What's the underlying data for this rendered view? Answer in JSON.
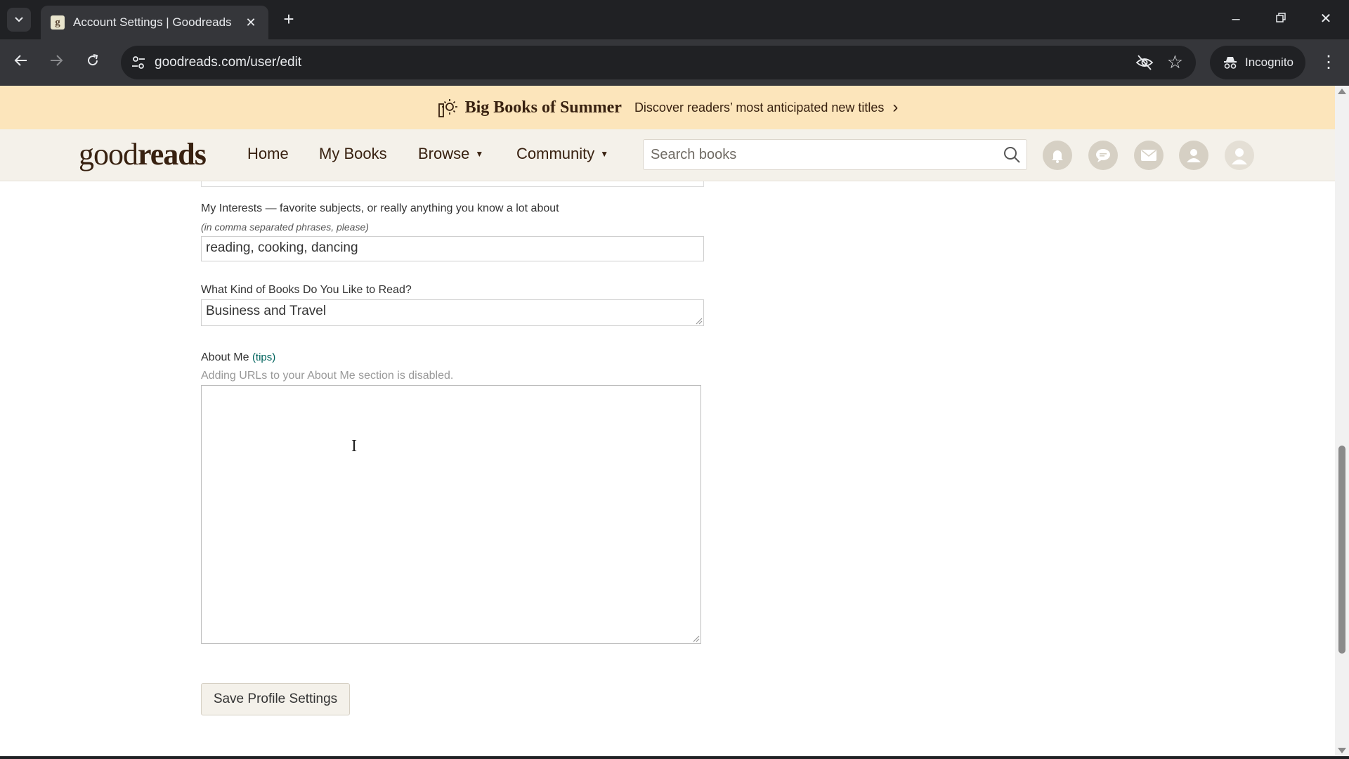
{
  "browser": {
    "tab_title": "Account Settings | Goodreads",
    "tab_favicon": "g",
    "url": "goodreads.com/user/edit",
    "profile_label": "Incognito"
  },
  "banner": {
    "title": "Big Books of Summer",
    "text": "Discover readers’ most anticipated new titles",
    "arrow": "›",
    "icon": "sun-icon"
  },
  "header": {
    "logo_light": "good",
    "logo_bold": "reads",
    "nav": {
      "home": "Home",
      "my_books": "My Books",
      "browse": "Browse",
      "community": "Community"
    },
    "search_placeholder": "Search books",
    "icons": [
      "notifications-icon",
      "discussions-icon",
      "messages-icon",
      "friends-icon",
      "profile-icon"
    ]
  },
  "form": {
    "interests_label": "My Interests — favorite subjects, or really anything you know a lot about",
    "interests_hint": "(in comma separated phrases, please)",
    "interests_value": "reading, cooking, dancing",
    "books_label": "What Kind of Books Do You Like to Read?",
    "books_value": "Business and Travel",
    "about_label": "About Me",
    "about_tips": "(tips)",
    "about_note": "Adding URLs to your About Me section is disabled.",
    "about_value": "",
    "save_label": "Save Profile Settings"
  },
  "colors": {
    "chrome_dark": "#202124",
    "chrome_toolbar": "#35363a",
    "banner_bg": "#fce5bb",
    "header_bg": "#f4f1ea",
    "brand_text": "#382110",
    "link_green": "#00635d"
  }
}
